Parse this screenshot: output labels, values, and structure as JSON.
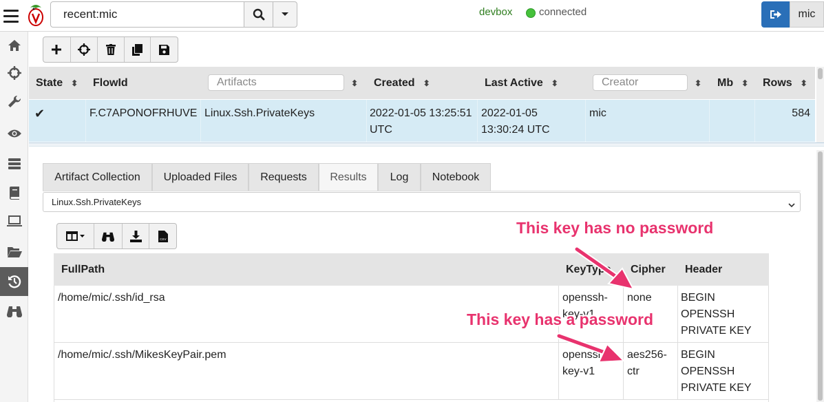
{
  "topbar": {
    "search_value": "recent:mic",
    "server": "devbox",
    "status": "connected",
    "user": "mic"
  },
  "sidebar": {
    "items": [
      "home-icon",
      "crosshair-icon",
      "wrench-icon",
      "eye-icon",
      "server-icon",
      "book-icon",
      "laptop-icon",
      "folder-open-icon",
      "history-icon",
      "binoculars-icon"
    ],
    "active": "history-icon"
  },
  "flows": {
    "toolbar": [
      "add-icon",
      "crosshair-icon",
      "trash-icon",
      "copy-icon",
      "save-icon"
    ],
    "columns": {
      "state": "State",
      "flowid": "FlowId",
      "artifacts_placeholder": "Artifacts",
      "created": "Created",
      "last_active": "Last Active",
      "creator_placeholder": "Creator",
      "mb": "Mb",
      "rows": "Rows"
    },
    "rows": [
      {
        "state": "✔",
        "flowid": "F.C7APONOFRHUVE",
        "artifacts": "Linux.Ssh.PrivateKeys",
        "created_1": "2022-01-05 13:25:51",
        "created_2": "UTC",
        "last_active_1": "2022-01-05",
        "last_active_2": "13:30:24 UTC",
        "creator": "mic",
        "mb": "",
        "rows": "584"
      }
    ]
  },
  "details": {
    "tabs": [
      "Artifact Collection",
      "Uploaded Files",
      "Requests",
      "Results",
      "Log",
      "Notebook"
    ],
    "active_tab": "Results",
    "artifact_select": "Linux.Ssh.PrivateKeys",
    "results_toolbar": [
      "columns-icon",
      "binoculars-icon",
      "download-icon",
      "csv-icon"
    ],
    "columns": {
      "fullpath": "FullPath",
      "keytype": "KeyType",
      "cipher": "Cipher",
      "header": "Header"
    },
    "rows": [
      {
        "fullpath": "/home/mic/.ssh/id_rsa",
        "keytype": [
          "openssh-",
          "key-v1"
        ],
        "cipher": [
          "none"
        ],
        "header": [
          "BEGIN",
          "OPENSSH",
          "PRIVATE KEY"
        ]
      },
      {
        "fullpath": "/home/mic/.ssh/MikesKeyPair.pem",
        "keytype": [
          "openssh-",
          "key-v1"
        ],
        "cipher": [
          "aes256-",
          "ctr"
        ],
        "header": [
          "BEGIN",
          "OPENSSH",
          "PRIVATE KEY"
        ]
      }
    ]
  },
  "annotations": {
    "no_password": "This key has no password",
    "has_password": "This key has a password",
    "color": "#e8336e"
  }
}
